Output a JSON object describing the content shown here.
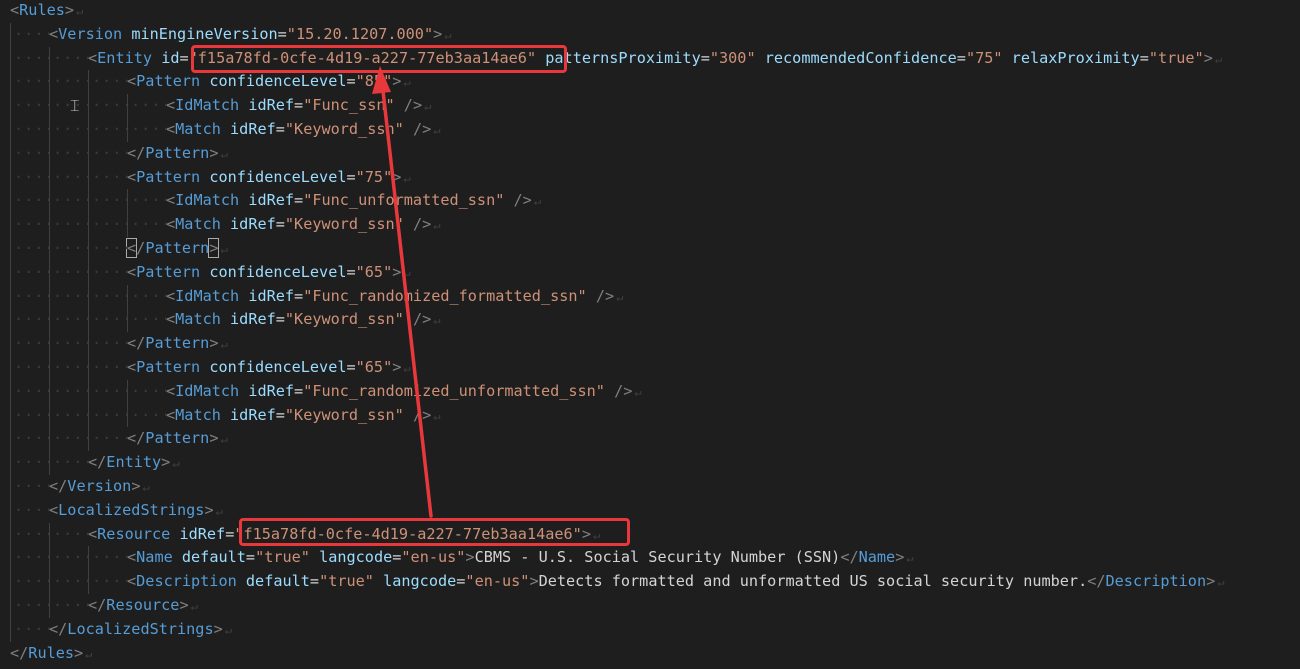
{
  "colors": {
    "background": "#1e1e1e",
    "punctuation": "#808080",
    "tag": "#569cd6",
    "attribute": "#9cdcfe",
    "value": "#ce9178",
    "text": "#d4d4d4",
    "annotation": "#e8383c"
  },
  "lines": [
    {
      "indent": 0,
      "tokens": [
        [
          "p",
          "<"
        ],
        [
          "t",
          "Rules"
        ],
        [
          "p",
          ">"
        ],
        [
          "r",
          "↵"
        ]
      ]
    },
    {
      "indent": 1,
      "tokens": [
        [
          "p",
          "<"
        ],
        [
          "t",
          "Version"
        ],
        [
          "x",
          " "
        ],
        [
          "a",
          "minEngineVersion"
        ],
        [
          "e",
          "="
        ],
        [
          "v",
          "\"15.20.1207.000\""
        ],
        [
          "p",
          ">"
        ],
        [
          "r",
          "↵"
        ]
      ]
    },
    {
      "indent": 2,
      "tokens": [
        [
          "p",
          "<"
        ],
        [
          "t",
          "Entity"
        ],
        [
          "x",
          " "
        ],
        [
          "a",
          "id"
        ],
        [
          "e",
          "="
        ],
        [
          "v",
          "\"f15a78fd-0cfe-4d19-a227-77eb3aa14ae6\""
        ],
        [
          "x",
          " "
        ],
        [
          "a",
          "patternsProximity"
        ],
        [
          "e",
          "="
        ],
        [
          "v",
          "\"300\""
        ],
        [
          "x",
          " "
        ],
        [
          "a",
          "recommendedConfidence"
        ],
        [
          "e",
          "="
        ],
        [
          "v",
          "\"75\""
        ],
        [
          "x",
          " "
        ],
        [
          "a",
          "relaxProximity"
        ],
        [
          "e",
          "="
        ],
        [
          "v",
          "\"true\""
        ],
        [
          "p",
          ">"
        ],
        [
          "r",
          "↵"
        ]
      ]
    },
    {
      "indent": 3,
      "tokens": [
        [
          "p",
          "<"
        ],
        [
          "t",
          "Pattern"
        ],
        [
          "x",
          " "
        ],
        [
          "a",
          "confidenceLevel"
        ],
        [
          "e",
          "="
        ],
        [
          "v",
          "\"85\""
        ],
        [
          "p",
          ">"
        ],
        [
          "r",
          "↵"
        ]
      ]
    },
    {
      "indent": 4,
      "tokens": [
        [
          "p",
          "<"
        ],
        [
          "t",
          "IdMatch"
        ],
        [
          "x",
          " "
        ],
        [
          "a",
          "idRef"
        ],
        [
          "e",
          "="
        ],
        [
          "v",
          "\"Func_ssn\""
        ],
        [
          "x",
          " "
        ],
        [
          "p",
          "/>"
        ],
        [
          "r",
          "↵"
        ]
      ]
    },
    {
      "indent": 4,
      "tokens": [
        [
          "p",
          "<"
        ],
        [
          "t",
          "Match"
        ],
        [
          "x",
          " "
        ],
        [
          "a",
          "idRef"
        ],
        [
          "e",
          "="
        ],
        [
          "v",
          "\"Keyword_ssn\""
        ],
        [
          "x",
          " "
        ],
        [
          "p",
          "/>"
        ],
        [
          "r",
          "↵"
        ]
      ]
    },
    {
      "indent": 3,
      "tokens": [
        [
          "p",
          "</"
        ],
        [
          "t",
          "Pattern"
        ],
        [
          "p",
          ">"
        ],
        [
          "r",
          "↵"
        ]
      ]
    },
    {
      "indent": 3,
      "tokens": [
        [
          "p",
          "<"
        ],
        [
          "t",
          "Pattern"
        ],
        [
          "x",
          " "
        ],
        [
          "a",
          "confidenceLevel"
        ],
        [
          "e",
          "="
        ],
        [
          "v",
          "\"75\""
        ],
        [
          "p",
          ">"
        ],
        [
          "r",
          "↵"
        ]
      ]
    },
    {
      "indent": 4,
      "tokens": [
        [
          "p",
          "<"
        ],
        [
          "t",
          "IdMatch"
        ],
        [
          "x",
          " "
        ],
        [
          "a",
          "idRef"
        ],
        [
          "e",
          "="
        ],
        [
          "v",
          "\"Func_unformatted_ssn\""
        ],
        [
          "x",
          " "
        ],
        [
          "p",
          "/>"
        ],
        [
          "r",
          "↵"
        ]
      ]
    },
    {
      "indent": 4,
      "tokens": [
        [
          "p",
          "<"
        ],
        [
          "t",
          "Match"
        ],
        [
          "x",
          " "
        ],
        [
          "a",
          "idRef"
        ],
        [
          "e",
          "="
        ],
        [
          "v",
          "\"Keyword_ssn\""
        ],
        [
          "x",
          " "
        ],
        [
          "p",
          "/>"
        ],
        [
          "r",
          "↵"
        ]
      ]
    },
    {
      "indent": 3,
      "tokens": [
        [
          "pc",
          "<"
        ],
        [
          "p",
          "/"
        ],
        [
          "t",
          "Pattern"
        ],
        [
          "pc",
          ">"
        ],
        [
          "r",
          "↵"
        ]
      ]
    },
    {
      "indent": 3,
      "tokens": [
        [
          "p",
          "<"
        ],
        [
          "t",
          "Pattern"
        ],
        [
          "x",
          " "
        ],
        [
          "a",
          "confidenceLevel"
        ],
        [
          "e",
          "="
        ],
        [
          "v",
          "\"65\""
        ],
        [
          "p",
          ">"
        ],
        [
          "r",
          "↵"
        ]
      ]
    },
    {
      "indent": 4,
      "tokens": [
        [
          "p",
          "<"
        ],
        [
          "t",
          "IdMatch"
        ],
        [
          "x",
          " "
        ],
        [
          "a",
          "idRef"
        ],
        [
          "e",
          "="
        ],
        [
          "v",
          "\"Func_randomized_formatted_ssn\""
        ],
        [
          "x",
          " "
        ],
        [
          "p",
          "/>"
        ],
        [
          "r",
          "↵"
        ]
      ]
    },
    {
      "indent": 4,
      "tokens": [
        [
          "p",
          "<"
        ],
        [
          "t",
          "Match"
        ],
        [
          "x",
          " "
        ],
        [
          "a",
          "idRef"
        ],
        [
          "e",
          "="
        ],
        [
          "v",
          "\"Keyword_ssn\""
        ],
        [
          "x",
          " "
        ],
        [
          "p",
          "/>"
        ],
        [
          "r",
          "↵"
        ]
      ]
    },
    {
      "indent": 3,
      "tokens": [
        [
          "p",
          "</"
        ],
        [
          "t",
          "Pattern"
        ],
        [
          "p",
          ">"
        ],
        [
          "r",
          "↵"
        ]
      ]
    },
    {
      "indent": 3,
      "tokens": [
        [
          "p",
          "<"
        ],
        [
          "t",
          "Pattern"
        ],
        [
          "x",
          " "
        ],
        [
          "a",
          "confidenceLevel"
        ],
        [
          "e",
          "="
        ],
        [
          "v",
          "\"65\""
        ],
        [
          "p",
          ">"
        ],
        [
          "r",
          "↵"
        ]
      ]
    },
    {
      "indent": 4,
      "tokens": [
        [
          "p",
          "<"
        ],
        [
          "t",
          "IdMatch"
        ],
        [
          "x",
          " "
        ],
        [
          "a",
          "idRef"
        ],
        [
          "e",
          "="
        ],
        [
          "v",
          "\"Func_randomized_unformatted_ssn\""
        ],
        [
          "x",
          " "
        ],
        [
          "p",
          "/>"
        ],
        [
          "r",
          "↵"
        ]
      ]
    },
    {
      "indent": 4,
      "tokens": [
        [
          "p",
          "<"
        ],
        [
          "t",
          "Match"
        ],
        [
          "x",
          " "
        ],
        [
          "a",
          "idRef"
        ],
        [
          "e",
          "="
        ],
        [
          "v",
          "\"Keyword_ssn\""
        ],
        [
          "x",
          " "
        ],
        [
          "p",
          "/>"
        ],
        [
          "r",
          "↵"
        ]
      ]
    },
    {
      "indent": 3,
      "tokens": [
        [
          "p",
          "</"
        ],
        [
          "t",
          "Pattern"
        ],
        [
          "p",
          ">"
        ],
        [
          "r",
          "↵"
        ]
      ]
    },
    {
      "indent": 2,
      "tokens": [
        [
          "p",
          "</"
        ],
        [
          "t",
          "Entity"
        ],
        [
          "p",
          ">"
        ],
        [
          "r",
          "↵"
        ]
      ]
    },
    {
      "indent": 1,
      "tokens": [
        [
          "p",
          "</"
        ],
        [
          "t",
          "Version"
        ],
        [
          "p",
          ">"
        ],
        [
          "r",
          "↵"
        ]
      ]
    },
    {
      "indent": 1,
      "tokens": [
        [
          "p",
          "<"
        ],
        [
          "t",
          "LocalizedStrings"
        ],
        [
          "p",
          ">"
        ],
        [
          "r",
          "↵"
        ]
      ]
    },
    {
      "indent": 2,
      "tokens": [
        [
          "p",
          "<"
        ],
        [
          "t",
          "Resource"
        ],
        [
          "x",
          " "
        ],
        [
          "a",
          "idRef"
        ],
        [
          "e",
          "="
        ],
        [
          "v",
          "\"f15a78fd-0cfe-4d19-a227-77eb3aa14ae6\""
        ],
        [
          "p",
          ">"
        ],
        [
          "r",
          "↵"
        ]
      ]
    },
    {
      "indent": 3,
      "tokens": [
        [
          "p",
          "<"
        ],
        [
          "t",
          "Name"
        ],
        [
          "x",
          " "
        ],
        [
          "a",
          "default"
        ],
        [
          "e",
          "="
        ],
        [
          "v",
          "\"true\""
        ],
        [
          "x",
          " "
        ],
        [
          "a",
          "langcode"
        ],
        [
          "e",
          "="
        ],
        [
          "v",
          "\"en-us\""
        ],
        [
          "p",
          ">"
        ],
        [
          "x",
          "CBMS - U.S. Social Security Number (SSN)"
        ],
        [
          "p",
          "</"
        ],
        [
          "t",
          "Name"
        ],
        [
          "p",
          ">"
        ],
        [
          "r",
          "↵"
        ]
      ]
    },
    {
      "indent": 3,
      "tokens": [
        [
          "p",
          "<"
        ],
        [
          "t",
          "Description"
        ],
        [
          "x",
          " "
        ],
        [
          "a",
          "default"
        ],
        [
          "e",
          "="
        ],
        [
          "v",
          "\"true\""
        ],
        [
          "x",
          " "
        ],
        [
          "a",
          "langcode"
        ],
        [
          "e",
          "="
        ],
        [
          "v",
          "\"en-us\""
        ],
        [
          "p",
          ">"
        ],
        [
          "x",
          "Detects formatted and unformatted US social security number."
        ],
        [
          "p",
          "</"
        ],
        [
          "t",
          "Description"
        ],
        [
          "p",
          ">"
        ],
        [
          "r",
          "↵"
        ]
      ]
    },
    {
      "indent": 2,
      "tokens": [
        [
          "p",
          "</"
        ],
        [
          "t",
          "Resource"
        ],
        [
          "p",
          ">"
        ],
        [
          "r",
          "↵"
        ]
      ]
    },
    {
      "indent": 1,
      "tokens": [
        [
          "p",
          "</"
        ],
        [
          "t",
          "LocalizedStrings"
        ],
        [
          "p",
          ">"
        ],
        [
          "r",
          "↵"
        ]
      ]
    },
    {
      "indent": 0,
      "tokens": [
        [
          "p",
          "</"
        ],
        [
          "t",
          "Rules"
        ],
        [
          "p",
          ">"
        ],
        [
          "r",
          "↵"
        ]
      ]
    }
  ]
}
